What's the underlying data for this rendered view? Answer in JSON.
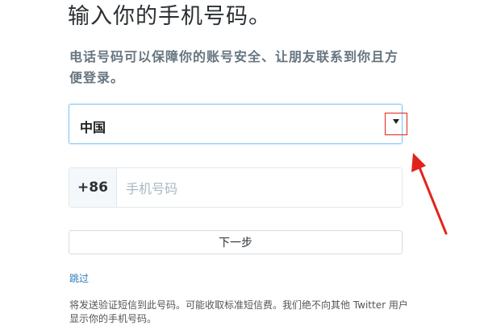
{
  "page": {
    "title": "输入你的手机号码。",
    "description": "电话号码可以保障你的账号安全、让朋友联系到你且方便登录。"
  },
  "country_select": {
    "value": "中国",
    "caret_icon": "caret-down-icon"
  },
  "phone": {
    "country_code": "+86",
    "placeholder": "手机号码",
    "value": ""
  },
  "actions": {
    "next_label": "下一步",
    "skip_label": "跳过"
  },
  "footnote": "将发送验证短信到此号码。可能收取标准短信费。我们绝不向其他 Twitter 用户显示你的手机号码。",
  "annotation": {
    "highlight_color": "#e2231a",
    "arrow_icon": "red-arrow-icon"
  }
}
